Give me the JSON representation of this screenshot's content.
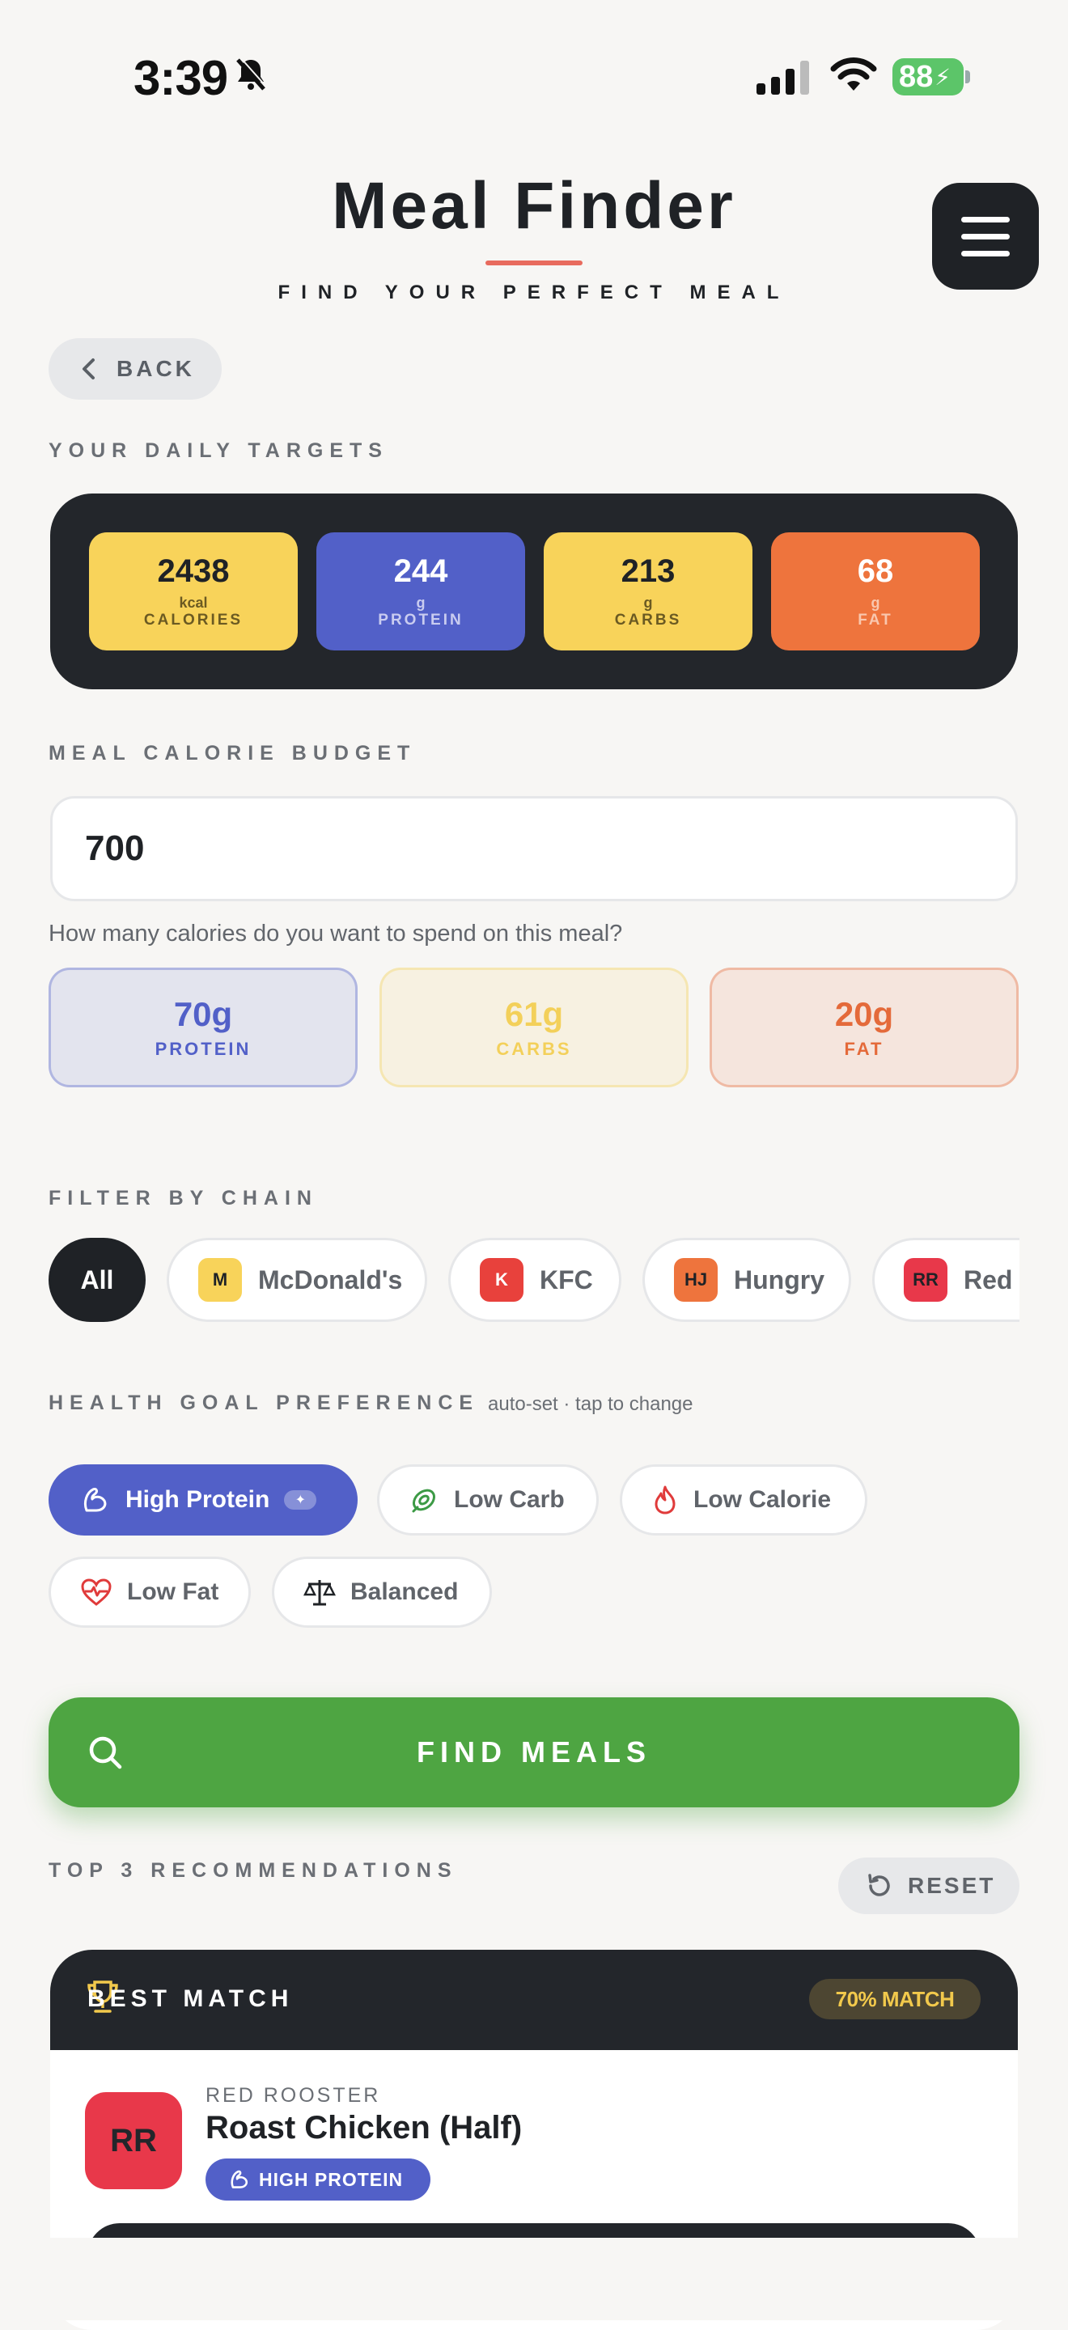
{
  "status_bar": {
    "time": "3:39",
    "battery": "88"
  },
  "header": {
    "title": "Meal Finder",
    "subtitle": "FIND YOUR PERFECT MEAL",
    "back_label": "BACK"
  },
  "daily_targets": {
    "label": "YOUR DAILY TARGETS",
    "items": [
      {
        "value": "2438",
        "unit": "kcal",
        "label": "CALORIES",
        "bg": "#F8D35A",
        "fg": "#1F2226",
        "sub": "#6B5A22"
      },
      {
        "value": "244",
        "unit": "g",
        "label": "PROTEIN",
        "bg": "#5260C8",
        "fg": "#FFFFFF",
        "sub": "#C9CCF0"
      },
      {
        "value": "213",
        "unit": "g",
        "label": "CARBS",
        "bg": "#F8D35A",
        "fg": "#1F2226",
        "sub": "#6B5A22"
      },
      {
        "value": "68",
        "unit": "g",
        "label": "FAT",
        "bg": "#EE743D",
        "fg": "#FFFFFF",
        "sub": "#F9C7AE"
      }
    ]
  },
  "budget": {
    "label": "MEAL CALORIE BUDGET",
    "value": "700",
    "helper": "How many calories do you want to spend on this meal?",
    "macros": [
      {
        "value": "70g",
        "label": "PROTEIN",
        "color": "#5260C8"
      },
      {
        "value": "61g",
        "label": "CARBS",
        "color": "#F3D05A"
      },
      {
        "value": "20g",
        "label": "FAT",
        "color": "#E46A3A"
      }
    ]
  },
  "chains": {
    "label": "FILTER BY CHAIN",
    "items": [
      {
        "name": "All",
        "badge": ""
      },
      {
        "name": "McDonald's",
        "badge": "M",
        "badge_bg": "#F8D35A",
        "badge_fg": "#1F2226"
      },
      {
        "name": "KFC",
        "badge": "K",
        "badge_bg": "#E8413C",
        "badge_fg": "#FFFFFF"
      },
      {
        "name": "Hungry",
        "badge": "HJ",
        "badge_bg": "#EE743D",
        "badge_fg": "#1F2226"
      },
      {
        "name": "Red",
        "badge": "RR",
        "badge_bg": "#E8384A",
        "badge_fg": "#1F2226"
      }
    ]
  },
  "goals": {
    "label": "HEALTH GOAL PREFERENCE",
    "note": "auto-set · tap to change",
    "items": [
      "High Protein",
      "Low Carb",
      "Low Calorie",
      "Low Fat",
      "Balanced"
    ],
    "active": "High Protein",
    "active_badge": "✦"
  },
  "find_button": "FIND MEALS",
  "results": {
    "label": "TOP 3 RECOMMENDATIONS",
    "reset_label": "RESET",
    "best": {
      "header": "BEST MATCH",
      "match": "70% MATCH",
      "logo": "RR",
      "restaurant": "RED ROOSTER",
      "meal": "Roast Chicken (Half)",
      "tag": "HIGH PROTEIN"
    }
  }
}
